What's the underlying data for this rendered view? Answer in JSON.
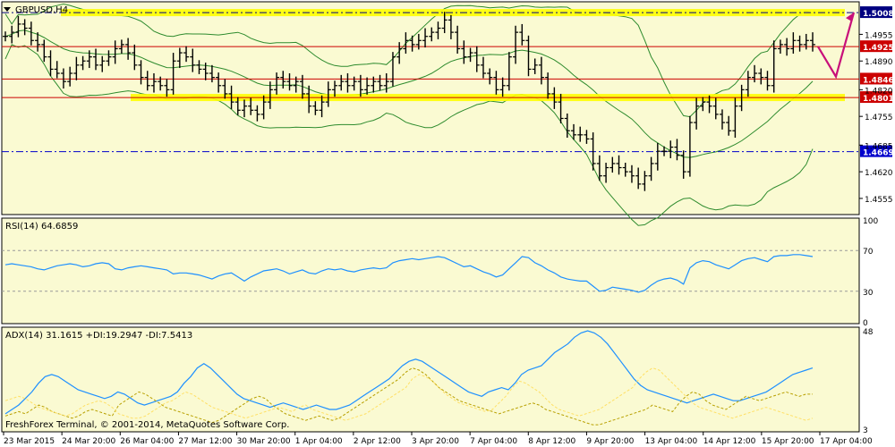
{
  "chart_data": [
    {
      "type": "ohlc",
      "title": "GBPUSD,H4",
      "overlay": "Bollinger Bands",
      "ylim": [
        1.452,
        1.503
      ],
      "y_ticks": [
        "1.4955",
        "1.4890",
        "1.4820",
        "1.4755",
        "1.4685",
        "1.4620",
        "1.4555"
      ],
      "x_ticks": [
        "23 Mar 2015",
        "24 Mar 20:00",
        "26 Mar 04:00",
        "27 Mar 12:00",
        "30 Mar 20:00",
        "1 Apr 04:00",
        "2 Apr 12:00",
        "3 Apr 20:00",
        "7 Apr 04:00",
        "8 Apr 12:00",
        "9 Apr 20:00",
        "13 Apr 04:00",
        "14 Apr 12:00",
        "15 Apr 20:00",
        "17 Apr 04:00"
      ],
      "levels": [
        {
          "value": 1.5008,
          "label": "1.5008",
          "style": "dash-dot-yellow-band",
          "color": "#000080"
        },
        {
          "value": 1.4925,
          "label": "1.4925",
          "style": "solid",
          "color": "#cc0000"
        },
        {
          "value": 1.4846,
          "label": "1.4846",
          "style": "solid",
          "color": "#cc0000"
        },
        {
          "value": 1.4801,
          "label": "1.4801",
          "style": "solid-yellow-band",
          "color": "#cc0000"
        },
        {
          "value": 1.4669,
          "label": "1.4669",
          "style": "dash-dot",
          "color": "#0000cc"
        }
      ],
      "close_series": [
        1.495,
        1.496,
        1.498,
        1.497,
        1.494,
        1.493,
        1.49,
        1.487,
        1.486,
        1.484,
        1.486,
        1.488,
        1.489,
        1.49,
        1.488,
        1.489,
        1.49,
        1.492,
        1.493,
        1.491,
        1.488,
        1.485,
        1.483,
        1.484,
        1.483,
        1.482,
        1.489,
        1.491,
        1.49,
        1.488,
        1.487,
        1.486,
        1.485,
        1.483,
        1.481,
        1.479,
        1.477,
        1.478,
        1.477,
        1.476,
        1.479,
        1.482,
        1.485,
        1.484,
        1.483,
        1.484,
        1.481,
        1.478,
        1.477,
        1.479,
        1.482,
        1.483,
        1.484,
        1.483,
        1.484,
        1.482,
        1.483,
        1.484,
        1.483,
        1.484,
        1.49,
        1.492,
        1.494,
        1.493,
        1.494,
        1.495,
        1.496,
        1.497,
        1.499,
        1.496,
        1.492,
        1.49,
        1.491,
        1.488,
        1.486,
        1.485,
        1.482,
        1.483,
        1.49,
        1.496,
        1.494,
        1.487,
        1.488,
        1.485,
        1.481,
        1.479,
        1.475,
        1.472,
        1.471,
        1.471,
        1.47,
        1.464,
        1.461,
        1.463,
        1.464,
        1.463,
        1.462,
        1.461,
        1.459,
        1.461,
        1.464,
        1.467,
        1.467,
        1.468,
        1.466,
        1.462,
        1.474,
        1.478,
        1.479,
        1.478,
        1.476,
        1.474,
        1.472,
        1.478,
        1.482,
        1.485,
        1.486,
        1.485,
        1.483,
        1.492,
        1.493,
        1.492,
        1.494,
        1.493,
        1.494,
        1.493
      ],
      "projection": [
        [
          1.4925,
          "17 Apr 04:00"
        ],
        [
          1.4852,
          "17 Apr 12:00"
        ],
        [
          1.5008,
          "17 Apr 20:00"
        ]
      ]
    },
    {
      "type": "line",
      "title": "RSI(14) 64.6859",
      "y_ticks": [
        "100",
        "70",
        "30",
        "0"
      ],
      "ylim": [
        0,
        100
      ],
      "levels": [
        70,
        30
      ],
      "series": [
        {
          "values": [
            56,
            57,
            56,
            55,
            54,
            52,
            51,
            53,
            55,
            56,
            57,
            56,
            54,
            55,
            57,
            58,
            57,
            52,
            51,
            53,
            54,
            55,
            54,
            53,
            52,
            51,
            47,
            48,
            48,
            47,
            46,
            44,
            42,
            45,
            47,
            48,
            44,
            40,
            44,
            47,
            50,
            51,
            52,
            50,
            47,
            49,
            51,
            48,
            47,
            50,
            52,
            51,
            52,
            50,
            49,
            51,
            52,
            53,
            52,
            53,
            58,
            60,
            61,
            62,
            61,
            62,
            63,
            64,
            63,
            60,
            57,
            54,
            55,
            52,
            49,
            47,
            44,
            46,
            52,
            58,
            64,
            63,
            58,
            55,
            51,
            48,
            44,
            42,
            41,
            40,
            40,
            35,
            30,
            31,
            34,
            33,
            32,
            31,
            29,
            31,
            36,
            40,
            42,
            43,
            41,
            37,
            53,
            58,
            60,
            59,
            56,
            54,
            52,
            56,
            60,
            62,
            63,
            61,
            59,
            64,
            65,
            65,
            66,
            66,
            65,
            64
          ]
        }
      ]
    },
    {
      "type": "line",
      "title": "ADX(14) 31.1615 +DI:19.2947 -DI:7.5413",
      "y_ticks": [
        "48",
        "3"
      ],
      "ylim": [
        3,
        48
      ],
      "series": [
        {
          "values": [
            10,
            12,
            14,
            17,
            20,
            24,
            27,
            28,
            27,
            25,
            23,
            21,
            20,
            19,
            18,
            17,
            18,
            20,
            19,
            17,
            15,
            14,
            15,
            16,
            17,
            18,
            20,
            24,
            27,
            31,
            33,
            31,
            28,
            25,
            22,
            19,
            17,
            16,
            15,
            14,
            13,
            14,
            15,
            14,
            13,
            12,
            13,
            14,
            13,
            12,
            12,
            13,
            14,
            16,
            18,
            20,
            22,
            24,
            26,
            29,
            32,
            34,
            35,
            34,
            32,
            30,
            28,
            26,
            24,
            22,
            20,
            19,
            18,
            20,
            21,
            22,
            21,
            24,
            28,
            30,
            31,
            32,
            35,
            38,
            40,
            42,
            45,
            47,
            48,
            47,
            45,
            42,
            38,
            34,
            30,
            26,
            23,
            21,
            20,
            19,
            18,
            17,
            16,
            15,
            16,
            17,
            18,
            19,
            18,
            17,
            16,
            16,
            17,
            18,
            19,
            20,
            22,
            24,
            26,
            28,
            29,
            30,
            31
          ]
        },
        {
          "values": [
            9,
            10,
            11,
            10,
            12,
            14,
            13,
            11,
            10,
            9,
            8,
            9,
            11,
            12,
            11,
            10,
            9,
            14,
            16,
            18,
            20,
            19,
            17,
            15,
            13,
            12,
            11,
            10,
            9,
            8,
            7,
            6,
            7,
            9,
            11,
            13,
            15,
            17,
            18,
            17,
            14,
            12,
            10,
            9,
            8,
            7,
            8,
            9,
            8,
            7,
            8,
            10,
            12,
            14,
            16,
            18,
            20,
            22,
            24,
            26,
            29,
            31,
            30,
            28,
            25,
            22,
            20,
            18,
            16,
            15,
            14,
            13,
            12,
            11,
            10,
            11,
            12,
            13,
            14,
            15,
            14,
            12,
            11,
            10,
            9,
            8,
            7,
            6,
            5,
            5,
            6,
            7,
            8,
            9,
            10,
            11,
            12,
            14,
            13,
            12,
            11,
            15,
            18,
            20,
            19,
            16,
            14,
            13,
            12,
            14,
            16,
            18,
            17,
            16,
            17,
            18,
            19,
            20,
            19,
            18,
            19,
            19
          ]
        },
        {
          "values": [
            16,
            17,
            18,
            17,
            15,
            13,
            12,
            11,
            10,
            9,
            10,
            12,
            14,
            15,
            16,
            15,
            13,
            10,
            9,
            8,
            8,
            9,
            11,
            13,
            15,
            16,
            18,
            20,
            19,
            17,
            15,
            13,
            12,
            11,
            10,
            9,
            8,
            9,
            10,
            11,
            12,
            13,
            12,
            11,
            13,
            14,
            12,
            11,
            10,
            9,
            8,
            7,
            8,
            9,
            10,
            12,
            14,
            16,
            18,
            20,
            22,
            26,
            28,
            27,
            25,
            22,
            19,
            17,
            15,
            14,
            13,
            12,
            11,
            12,
            15,
            18,
            22,
            25,
            24,
            22,
            20,
            17,
            14,
            12,
            11,
            10,
            9,
            10,
            11,
            12,
            14,
            16,
            18,
            20,
            22,
            26,
            29,
            31,
            30,
            27,
            24,
            21,
            18,
            15,
            13,
            12,
            11,
            10,
            9,
            8,
            9,
            10,
            11,
            12,
            13,
            12,
            11,
            10,
            9,
            8,
            7,
            8
          ]
        }
      ]
    }
  ],
  "footer": {
    "copyright": "FreshForex Terminal, © 2001-2014, MetaQuotes Software Corp."
  },
  "colors": {
    "bg": "#fafad2",
    "price": "#000000",
    "bands": "#2e8b2e",
    "rsi": "#1e90ff",
    "adx": "#1e90ff",
    "di_plus": "#b8a000",
    "di_minus": "#ffe066",
    "arrow": "#c8107a",
    "band": "#ffff00"
  }
}
